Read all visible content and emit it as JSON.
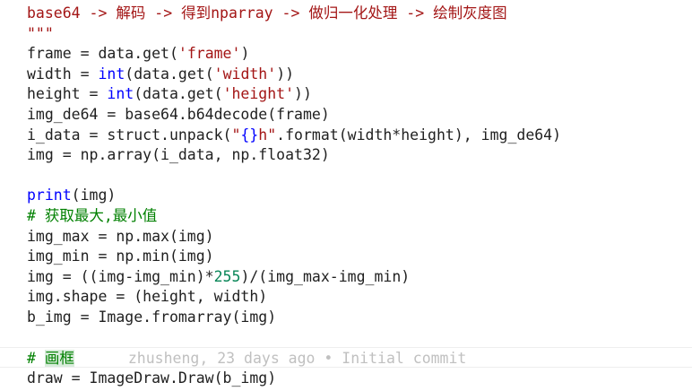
{
  "editor": {
    "lines": [
      {
        "tokens": [
          {
            "t": "base64 -> 解码 -> 得到nparray -> 做归一化处理 -> 绘制灰度图",
            "c": "str"
          }
        ]
      },
      {
        "tokens": [
          {
            "t": "\"\"\"",
            "c": "str"
          }
        ]
      },
      {
        "tokens": [
          {
            "t": "frame = data.get(",
            "c": "plain"
          },
          {
            "t": "'frame'",
            "c": "str"
          },
          {
            "t": ")",
            "c": "plain"
          }
        ]
      },
      {
        "tokens": [
          {
            "t": "width = ",
            "c": "plain"
          },
          {
            "t": "int",
            "c": "fn"
          },
          {
            "t": "(data.get(",
            "c": "plain"
          },
          {
            "t": "'width'",
            "c": "str"
          },
          {
            "t": "))",
            "c": "plain"
          }
        ]
      },
      {
        "tokens": [
          {
            "t": "height = ",
            "c": "plain"
          },
          {
            "t": "int",
            "c": "fn"
          },
          {
            "t": "(data.get(",
            "c": "plain"
          },
          {
            "t": "'height'",
            "c": "str"
          },
          {
            "t": "))",
            "c": "plain"
          }
        ]
      },
      {
        "tokens": [
          {
            "t": "img_de64 = base64.b64decode(frame)",
            "c": "plain"
          }
        ]
      },
      {
        "tokens": [
          {
            "t": "i_data = struct.unpack(",
            "c": "plain"
          },
          {
            "t": "\"",
            "c": "str"
          },
          {
            "t": "{}",
            "c": "kw"
          },
          {
            "t": "h\"",
            "c": "str"
          },
          {
            "t": ".format(width*height), img_de64)",
            "c": "plain"
          }
        ]
      },
      {
        "tokens": [
          {
            "t": "img = np.array(i_data, np.float32)",
            "c": "plain"
          }
        ]
      },
      {
        "tokens": []
      },
      {
        "tokens": [
          {
            "t": "print",
            "c": "fn"
          },
          {
            "t": "(img)",
            "c": "plain"
          }
        ]
      },
      {
        "tokens": [
          {
            "t": "# 获取最大,最小值",
            "c": "comment"
          }
        ]
      },
      {
        "tokens": [
          {
            "t": "img_max = np.max(img)",
            "c": "plain"
          }
        ]
      },
      {
        "tokens": [
          {
            "t": "img_min = np.min(img)",
            "c": "plain"
          }
        ]
      },
      {
        "tokens": [
          {
            "t": "img = ((img-img_min)*",
            "c": "plain"
          },
          {
            "t": "255",
            "c": "num"
          },
          {
            "t": ")/(img_max-img_min)",
            "c": "plain"
          }
        ]
      },
      {
        "tokens": [
          {
            "t": "img.shape = (height, width)",
            "c": "plain"
          }
        ]
      },
      {
        "tokens": [
          {
            "t": "b_img = Image.fromarray(img)",
            "c": "plain"
          }
        ]
      },
      {
        "tokens": []
      },
      {
        "tokens": [
          {
            "t": "# ",
            "c": "comment"
          },
          {
            "t": "画框",
            "c": "hl"
          }
        ],
        "blame": "zhusheng, 23 days ago • Initial commit",
        "current": true
      },
      {
        "tokens": [
          {
            "t": "draw = ImageDraw.Draw(b_img)",
            "c": "plain"
          }
        ]
      }
    ]
  }
}
